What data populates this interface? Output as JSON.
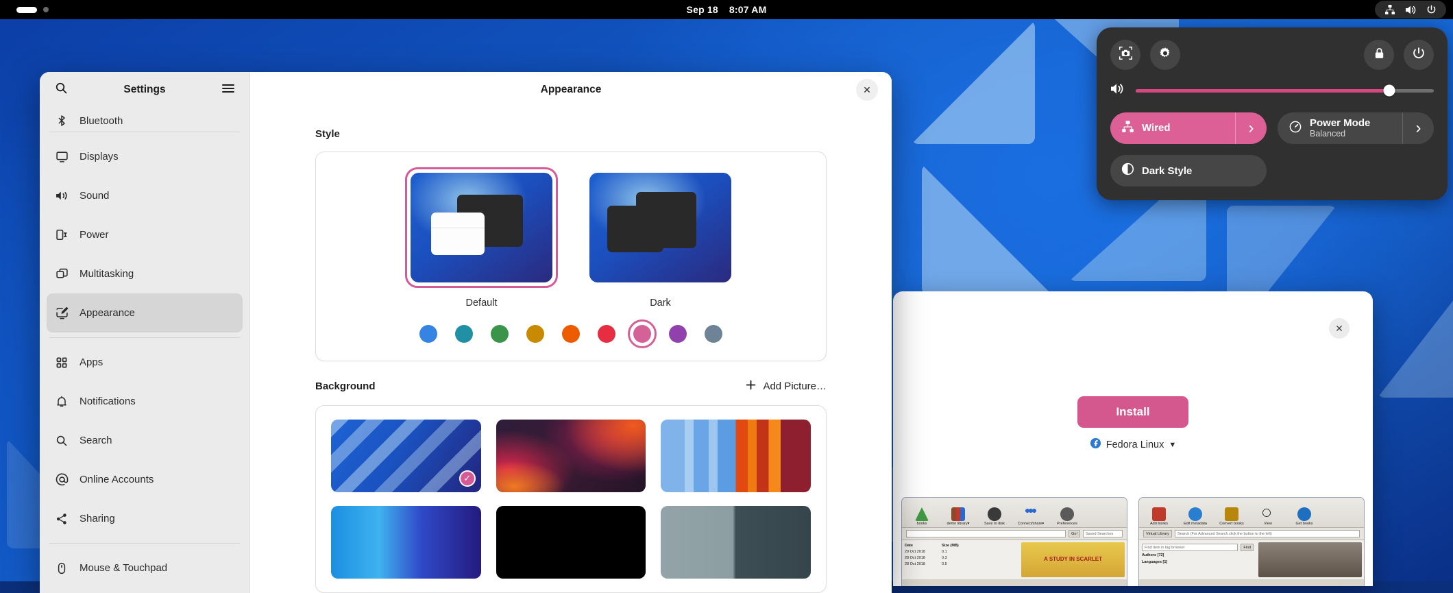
{
  "topbar": {
    "workspace_indicator": "workspace-dots",
    "date": "Sep 18",
    "time": "8:07 AM",
    "tray_icons": [
      "network-wired-icon",
      "volume-icon",
      "power-icon"
    ]
  },
  "quick_settings": {
    "buttons": {
      "screenshot": "screenshot-icon",
      "settings": "settings-gear-icon",
      "lock": "lock-icon",
      "power": "power-icon"
    },
    "volume": {
      "icon": "volume-icon",
      "percent": 85
    },
    "toggles": [
      {
        "title": "Wired",
        "subtitle": "",
        "icon": "network-wired-icon",
        "active": true,
        "arrow": "›"
      },
      {
        "title": "Power Mode",
        "subtitle": "Balanced",
        "icon": "speedometer-icon",
        "active": false,
        "arrow": "›"
      }
    ],
    "dark_style": {
      "title": "Dark Style",
      "icon": "half-circle-icon",
      "active": false
    }
  },
  "settings_window": {
    "sidebar": {
      "search_icon": "search-icon",
      "title": "Settings",
      "menu_icon": "hamburger-menu-icon",
      "groups": [
        {
          "items": [
            {
              "label": "Bluetooth",
              "icon": "bluetooth-icon",
              "selected": false,
              "clipped": true
            }
          ]
        },
        {
          "items": [
            {
              "label": "Displays",
              "icon": "display-icon",
              "selected": false
            },
            {
              "label": "Sound",
              "icon": "sound-icon",
              "selected": false
            },
            {
              "label": "Power",
              "icon": "power-plug-icon",
              "selected": false
            },
            {
              "label": "Multitasking",
              "icon": "multitasking-icon",
              "selected": false
            },
            {
              "label": "Appearance",
              "icon": "appearance-icon",
              "selected": true
            }
          ]
        },
        {
          "items": [
            {
              "label": "Apps",
              "icon": "apps-grid-icon",
              "selected": false
            },
            {
              "label": "Notifications",
              "icon": "bell-icon",
              "selected": false
            },
            {
              "label": "Search",
              "icon": "search-icon",
              "selected": false
            },
            {
              "label": "Online Accounts",
              "icon": "at-sign-icon",
              "selected": false
            },
            {
              "label": "Sharing",
              "icon": "share-icon",
              "selected": false
            }
          ]
        },
        {
          "items": [
            {
              "label": "Mouse & Touchpad",
              "icon": "mouse-icon",
              "selected": false
            }
          ]
        }
      ]
    },
    "content": {
      "title": "Appearance",
      "close_icon": "close-icon",
      "style_section": {
        "heading": "Style",
        "options": [
          {
            "label": "Default",
            "selected": true
          },
          {
            "label": "Dark",
            "selected": false
          }
        ],
        "accent_colors": [
          {
            "name": "blue",
            "hex": "#3584e4",
            "selected": false
          },
          {
            "name": "teal",
            "hex": "#2190a4",
            "selected": false
          },
          {
            "name": "green",
            "hex": "#3a944a",
            "selected": false
          },
          {
            "name": "yellow",
            "hex": "#c88a02",
            "selected": false
          },
          {
            "name": "orange",
            "hex": "#ed5b00",
            "selected": false
          },
          {
            "name": "red",
            "hex": "#e62d42",
            "selected": false
          },
          {
            "name": "pink",
            "hex": "#d56199",
            "selected": true
          },
          {
            "name": "purple",
            "hex": "#9141ac",
            "selected": false
          },
          {
            "name": "slate",
            "hex": "#6f8396",
            "selected": false
          }
        ]
      },
      "background_section": {
        "heading": "Background",
        "add_picture_label": "Add Picture…",
        "add_picture_icon": "plus-icon",
        "wallpapers": [
          {
            "name": "blue-geometric",
            "selected": true,
            "check_icon": "check-icon"
          },
          {
            "name": "dark-waves-red",
            "selected": false
          },
          {
            "name": "blue-orange-drip",
            "selected": false
          },
          {
            "name": "blue-indigo-gradient",
            "selected": false
          },
          {
            "name": "black-plain",
            "selected": false
          },
          {
            "name": "gray-slate",
            "selected": false
          }
        ]
      }
    }
  },
  "software_window": {
    "close_icon": "close-icon",
    "install_label": "Install",
    "source": {
      "label": "Fedora Linux",
      "icon": "fedora-icon",
      "dropdown_icon": "chevron-down-icon"
    },
    "screenshots": [
      {
        "name": "calibre-library-screenshot",
        "tools": [
          {
            "label": "books",
            "color": "#3f9a42"
          },
          {
            "label": "demo library▾",
            "color": "#8b4a2a"
          },
          {
            "label": "Save to disk",
            "color": "#3a3a3a"
          },
          {
            "label": "Connect/share▾",
            "color": "#2a6ad0"
          },
          {
            "label": "Preferences",
            "color": "#5a5a5a"
          }
        ],
        "search_placeholder": "",
        "go_label": "Go!",
        "saved_searches_label": "Saved Searches",
        "columns": [
          "Date",
          "Size (MB)"
        ],
        "rows": [
          [
            "29 Oct 2018",
            "0.1"
          ],
          [
            "28 Oct 2018",
            "0.3"
          ],
          [
            "28 Oct 2018",
            "0.5"
          ]
        ],
        "cover_text": "A STUDY IN SCARLET"
      },
      {
        "name": "calibre-toolbar-screenshot",
        "tools": [
          {
            "label": "Add books",
            "color": "#c0392b"
          },
          {
            "label": "Edit metadata",
            "color": "#2a7ed0"
          },
          {
            "label": "Convert books",
            "color": "#b8860b"
          },
          {
            "label": "View",
            "color": "#2b2b2b"
          },
          {
            "label": "Get books",
            "color": "#1f6fc0"
          }
        ],
        "virtual_library_label": "Virtual Library",
        "search_placeholder": "Search (For Advanced Search click the button to the left)",
        "find_placeholder": "Find item in tag browser",
        "find_label": "Find",
        "tree": [
          "Authors [72]",
          "Languages [1]"
        ]
      }
    ]
  }
}
